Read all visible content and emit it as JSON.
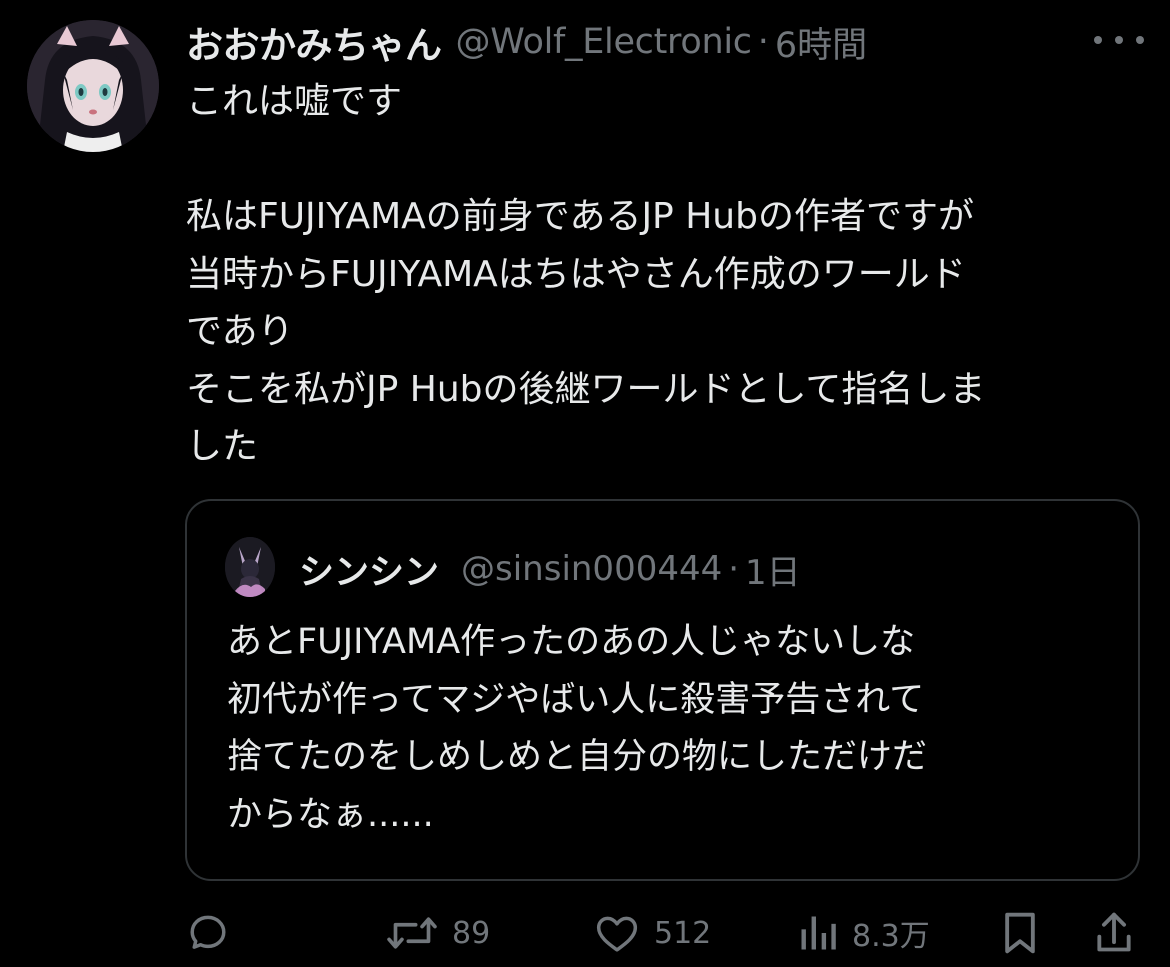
{
  "post": {
    "display_name": "おおかみちゃん",
    "handle": "@Wolf_Electronic",
    "separator": "·",
    "time": "6時間",
    "text_lines": [
      "これは嘘です",
      "",
      "私はFUJIYAMAの前身であるJP Hubの作者ですが",
      "当時からFUJIYAMAはちはやさん作成のワールド",
      "であり",
      "そこを私がJP Hubの後継ワールドとして指名しま",
      "した"
    ]
  },
  "quote": {
    "display_name": "シンシン",
    "handle": "@sinsin000444",
    "separator": "·",
    "time": "1日",
    "text_lines": [
      "あとFUJIYAMA作ったのあの人じゃないしな",
      "初代が作ってマジやばい人に殺害予告されて",
      "捨てたのをしめしめと自分の物にしただけだ",
      "からなぁ......"
    ]
  },
  "actions": {
    "reply_icon": "reply-icon",
    "retweet_icon": "retweet-icon",
    "retweet_count": "89",
    "like_icon": "heart-icon",
    "like_count": "512",
    "views_icon": "views-icon",
    "views_count": "8.3万",
    "bookmark_icon": "bookmark-icon",
    "share_icon": "share-icon"
  },
  "colors": {
    "background": "#000000",
    "primary_text": "#e7e9ea",
    "secondary_text": "#71767b",
    "border": "#2f3336"
  }
}
